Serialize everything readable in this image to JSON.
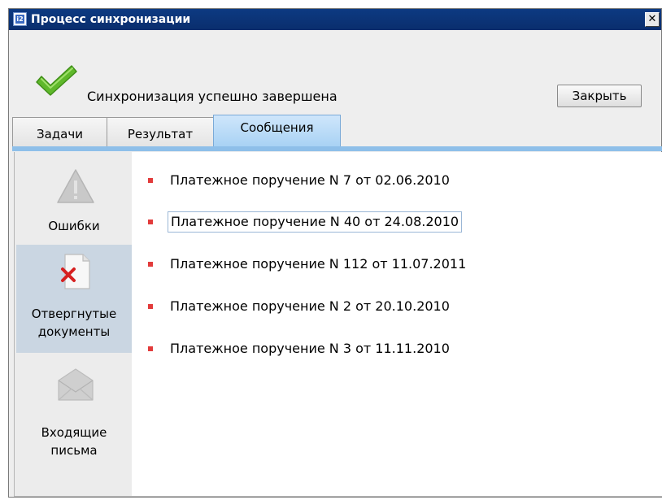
{
  "window": {
    "title": "Процесс синхронизации",
    "app_icon_label": "i2",
    "close_glyph": "✕"
  },
  "status": {
    "text": "Синхронизация успешно завершена",
    "icon": "checkmark-icon",
    "close_button_label": "Закрыть"
  },
  "tabs": [
    {
      "label": "Задачи",
      "active": false
    },
    {
      "label": "Результат",
      "active": false
    },
    {
      "label": "Сообщения",
      "active": true
    }
  ],
  "sidebar": {
    "items": [
      {
        "line1": "Ошибки",
        "line2": "",
        "icon": "warning-icon",
        "selected": false
      },
      {
        "line1": "Отвергнутые",
        "line2": "документы",
        "icon": "rejected-document-icon",
        "selected": true
      },
      {
        "line1": "Входящие",
        "line2": "письма",
        "icon": "envelope-icon",
        "selected": false
      }
    ]
  },
  "messages": [
    {
      "text": "Платежное поручение N 7 от 02.06.2010"
    },
    {
      "text": "Платежное поручение N 40 от 24.08.2010"
    },
    {
      "text": "Платежное поручение N 112 от 11.07.2011"
    },
    {
      "text": "Платежное поручение N 2 от 20.10.2010"
    },
    {
      "text": "Платежное поручение N 3 от 11.11.2010"
    }
  ],
  "colors": {
    "titlebar": "#0a2e6d",
    "tab_active": "#a9d2f4",
    "bullet": "#e23b3b",
    "check": "#5fb82b"
  }
}
